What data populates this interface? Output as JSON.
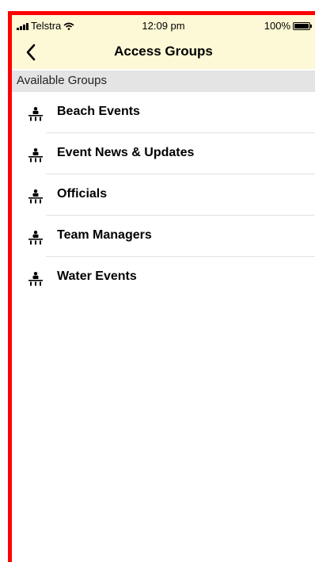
{
  "status_bar": {
    "carrier": "Telstra",
    "time": "12:09 pm",
    "battery": "100%"
  },
  "nav": {
    "title": "Access Groups",
    "back_icon": "chevron-left-icon"
  },
  "section": {
    "title": "Available Groups"
  },
  "groups": [
    {
      "label": "Beach Events",
      "icon": "group-icon"
    },
    {
      "label": "Event News & Updates",
      "icon": "group-icon"
    },
    {
      "label": "Officials",
      "icon": "group-icon"
    },
    {
      "label": "Team Managers",
      "icon": "group-icon"
    },
    {
      "label": "Water Events",
      "icon": "group-icon"
    }
  ],
  "colors": {
    "header_bg": "#fdf8d5",
    "section_bg": "#e4e4e4",
    "border": "#ff0000"
  }
}
